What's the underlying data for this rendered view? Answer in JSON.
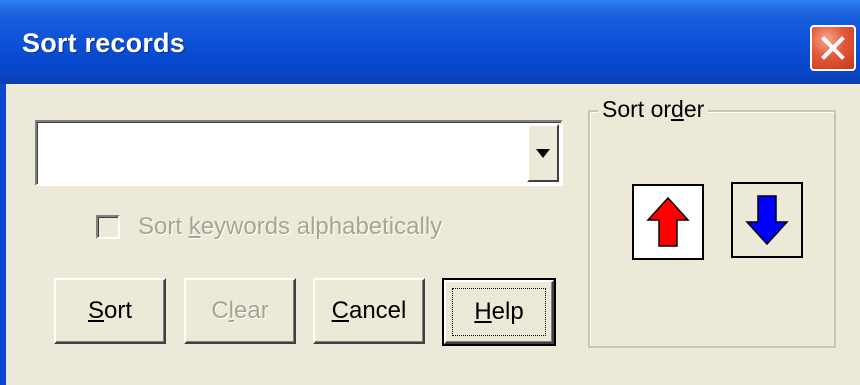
{
  "window": {
    "title": "Sort records"
  },
  "combo": {
    "value": "",
    "placeholder": ""
  },
  "checkbox": {
    "label_pre": "Sort ",
    "label_ul": "k",
    "label_post": "eywords alphabetically",
    "checked": false,
    "enabled": false
  },
  "buttons": {
    "sort": {
      "ul": "S",
      "rest": "ort"
    },
    "clear": {
      "ul": "",
      "pre": "C",
      "ul2": "l",
      "rest": "ear"
    },
    "cancel": {
      "ul": "C",
      "rest": "ancel"
    },
    "help": {
      "ul": "H",
      "rest": "elp"
    }
  },
  "sort_order": {
    "legend_pre": "Sort or",
    "legend_ul": "d",
    "legend_post": "er",
    "up_color": "#ff0000",
    "down_color": "#0000ff"
  },
  "icons": {
    "close": "close-icon",
    "dropdown": "chevron-down-icon",
    "ascending": "arrow-up-icon",
    "descending": "arrow-down-icon"
  }
}
